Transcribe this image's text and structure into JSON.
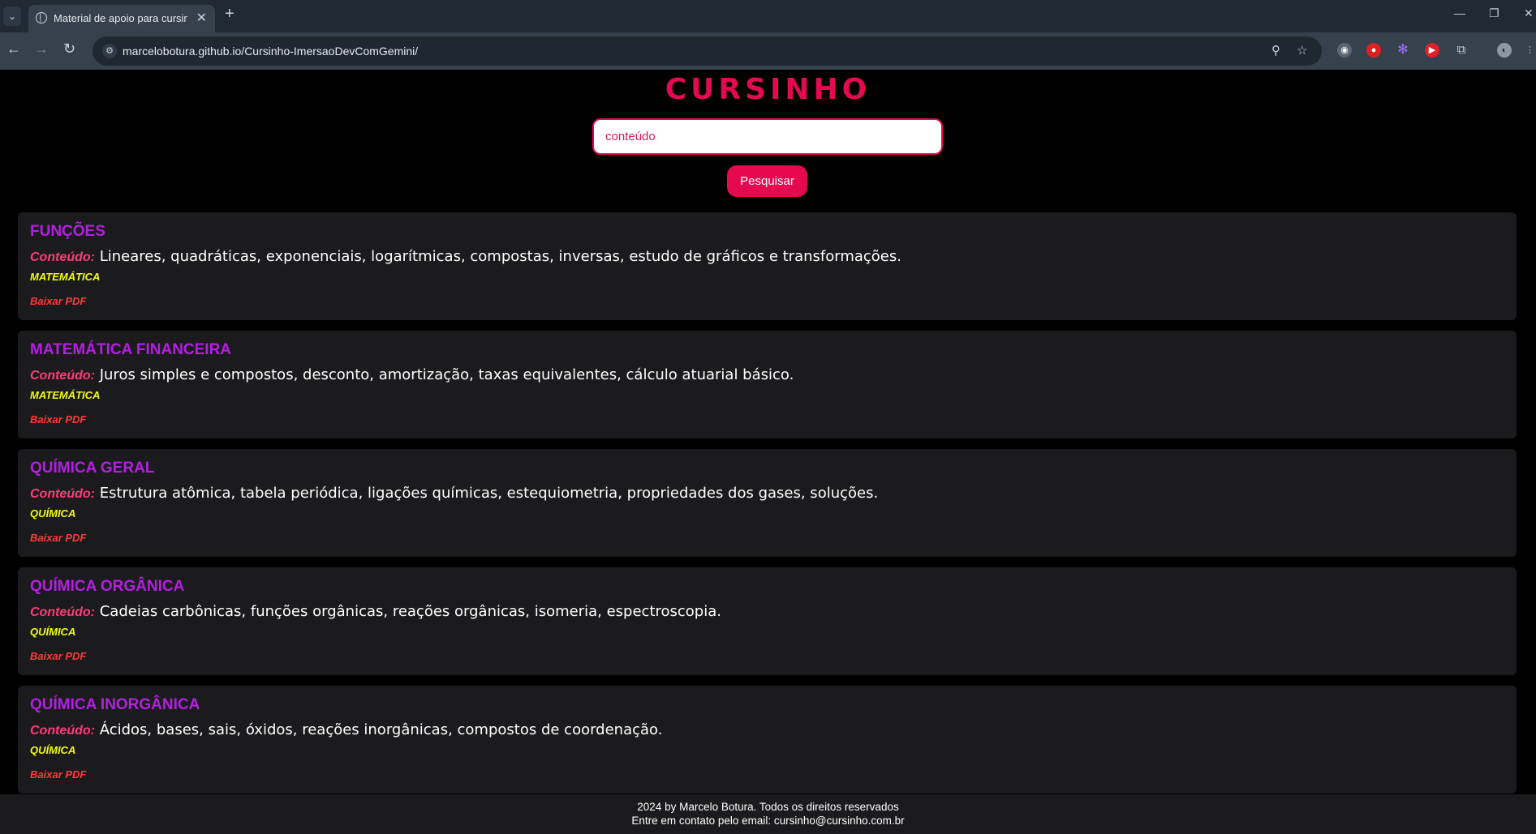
{
  "browser": {
    "tab_title": "Material de apoio para cursinho",
    "url": "marcelobotura.github.io/Cursinho-ImersaoDevComGemini/"
  },
  "header": {
    "title": "CURSINHO",
    "search_value": "",
    "search_placeholder": "conteúdo",
    "search_button": "Pesquisar"
  },
  "cards": [
    {
      "title": "FUNÇÕES",
      "content_label": "Conteúdo:",
      "content": "Lineares, quadráticas, exponenciais, logarítmicas, compostas, inversas, estudo de gráficos e transformações.",
      "subject": "MATEMÁTICA",
      "pdf_label": "Baixar PDF"
    },
    {
      "title": "MATEMÁTICA FINANCEIRA",
      "content_label": "Conteúdo:",
      "content": "Juros simples e compostos, desconto, amortização, taxas equivalentes, cálculo atuarial básico.",
      "subject": "MATEMÁTICA",
      "pdf_label": "Baixar PDF"
    },
    {
      "title": "QUÍMICA GERAL",
      "content_label": "Conteúdo:",
      "content": "Estrutura atômica, tabela periódica, ligações químicas, estequiometria, propriedades dos gases, soluções.",
      "subject": "QUÍMICA",
      "pdf_label": "Baixar PDF"
    },
    {
      "title": "QUÍMICA ORGÂNICA",
      "content_label": "Conteúdo:",
      "content": "Cadeias carbônicas, funções orgânicas, reações orgânicas, isomeria, espectroscopia.",
      "subject": "QUÍMICA",
      "pdf_label": "Baixar PDF"
    },
    {
      "title": "QUÍMICA INORGÂNICA",
      "content_label": "Conteúdo:",
      "content": "Ácidos, bases, sais, óxidos, reações inorgânicas, compostos de coordenação.",
      "subject": "QUÍMICA",
      "pdf_label": "Baixar PDF"
    }
  ],
  "footer": {
    "line1": "2024 by Marcelo Botura. Todos os direitos reservados",
    "line2": "Entre em contato pelo email: cursinho@cursinho.com.br"
  }
}
